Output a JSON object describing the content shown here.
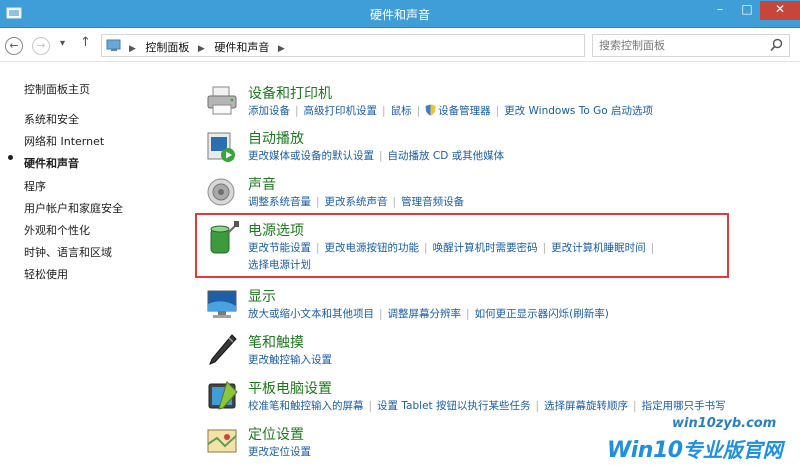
{
  "window": {
    "title": "硬件和声音",
    "minimize_label": "–",
    "maximize_label": "□",
    "close_label": "✕"
  },
  "address_bar": {
    "back_label": "←",
    "forward_label": "→",
    "recent_label": "▾",
    "up_label": "↑",
    "breadcrumbs": [
      "控制面板",
      "硬件和声音"
    ],
    "search_placeholder": "搜索控制面板"
  },
  "sidebar": {
    "items": [
      {
        "label": "控制面板主页"
      },
      {
        "label": "系统和安全"
      },
      {
        "label": "网络和 Internet"
      },
      {
        "label": "硬件和声音"
      },
      {
        "label": "程序"
      },
      {
        "label": "用户帐户和家庭安全"
      },
      {
        "label": "外观和个性化"
      },
      {
        "label": "时钟、语言和区域"
      },
      {
        "label": "轻松使用"
      }
    ]
  },
  "categories": [
    {
      "title": "设备和打印机",
      "icon": "printer-icon",
      "links": [
        "添加设备",
        "高级打印机设置",
        "鼠标",
        "设备管理器",
        "更改 Windows To Go 启动选项"
      ]
    },
    {
      "title": "自动播放",
      "icon": "autoplay-icon",
      "links": [
        "更改媒体或设备的默认设置",
        "自动播放 CD 或其他媒体"
      ]
    },
    {
      "title": "声音",
      "icon": "speaker-icon",
      "links": [
        "调整系统音量",
        "更改系统声音",
        "管理音频设备"
      ]
    },
    {
      "title": "电源选项",
      "icon": "battery-icon",
      "links": [
        "更改节能设置",
        "更改电源按钮的功能",
        "唤醒计算机时需要密码",
        "更改计算机睡眠时间",
        "选择电源计划"
      ]
    },
    {
      "title": "显示",
      "icon": "display-icon",
      "links": [
        "放大或缩小文本和其他项目",
        "调整屏幕分辨率",
        "如何更正显示器闪烁(刷新率)"
      ]
    },
    {
      "title": "笔和触摸",
      "icon": "pen-icon",
      "links": [
        "更改触控输入设置"
      ]
    },
    {
      "title": "平板电脑设置",
      "icon": "tablet-icon",
      "links": [
        "校准笔和触控输入的屏幕",
        "设置 Tablet 按钮以执行某些任务",
        "选择屏幕旋转顺序",
        "指定用哪只手书写"
      ]
    },
    {
      "title": "定位设置",
      "icon": "location-icon",
      "links": [
        "更改定位设置"
      ]
    }
  ],
  "watermark": {
    "brand": "Win10",
    "suffix": "专业版官网",
    "site": "win10zyb.com"
  },
  "colors": {
    "titlebar": "#3f9ed8",
    "link": "#1a5ea8",
    "category_title": "#1e7a1e",
    "highlight": "#e23a3a"
  }
}
